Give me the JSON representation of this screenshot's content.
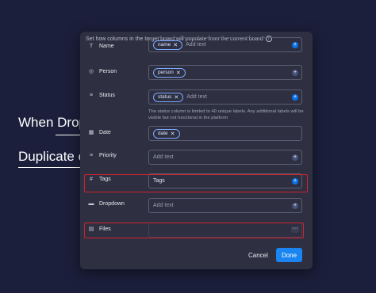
{
  "background": {
    "text1": "When Drop",
    "text2": "Duplicate c"
  },
  "modal": {
    "header": "Set how columns in the target board will populate from the current board",
    "rows": [
      {
        "label": "Name",
        "icon": "text-icon",
        "chip": "name",
        "placeholder": "Add text"
      },
      {
        "label": "Person",
        "icon": "person-icon",
        "chip": "person",
        "placeholder": ""
      },
      {
        "label": "Status",
        "icon": "status-icon",
        "chip": "status",
        "placeholder": "Add text"
      },
      {
        "label": "Date",
        "icon": "calendar-icon",
        "chip": "date",
        "placeholder": ""
      },
      {
        "label": "Priority",
        "icon": "priority-icon",
        "chip": "",
        "placeholder": "Add text"
      },
      {
        "label": "Tags",
        "icon": "hash-icon",
        "chip": "",
        "value": "Tags"
      },
      {
        "label": "Dropdown",
        "icon": "dropdown-icon",
        "chip": "",
        "placeholder": "Add text"
      },
      {
        "label": "Files",
        "icon": "file-icon",
        "chip": "",
        "placeholder": ""
      }
    ],
    "status_note": "The status column is limited to 40 unique labels. Any additional labels will be visible but not functional in the platform",
    "cancel_label": "Cancel",
    "done_label": "Done",
    "colors": {
      "accent": "#1a84f0",
      "highlight": "#d2222d"
    }
  }
}
